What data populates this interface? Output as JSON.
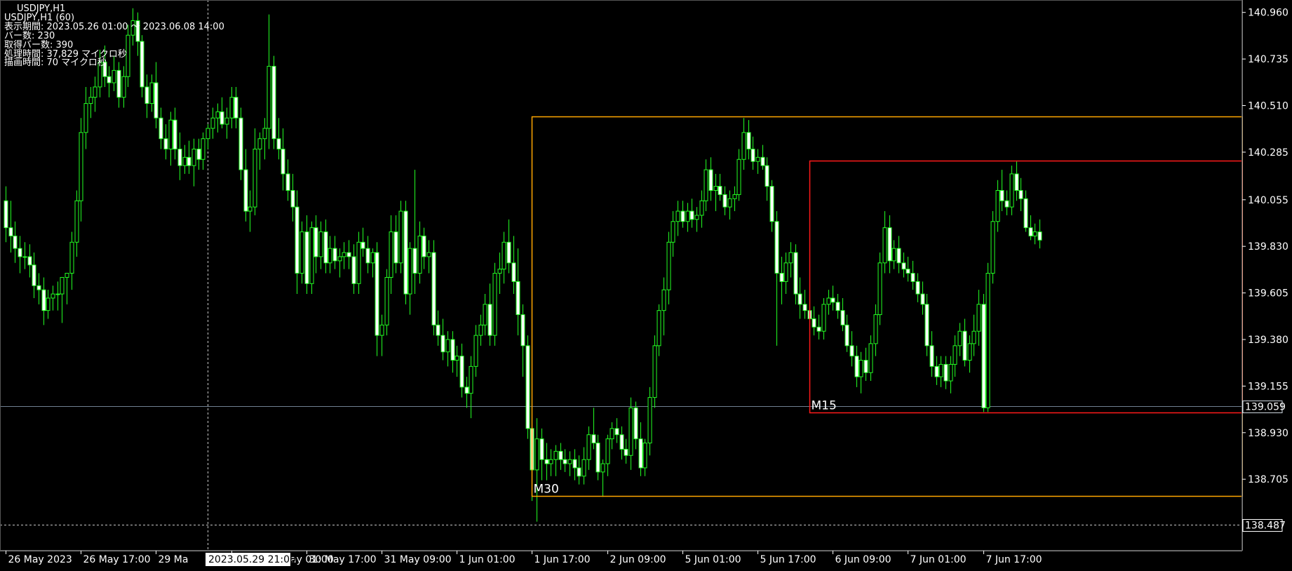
{
  "window": {
    "symbol_title": "USDJPY,H1"
  },
  "info_panel": {
    "lines": [
      "USDJPY,H1 (60)",
      "表示期間: 2023.05.26 01:00 ～ 2023.06.08 14:00",
      "バー数: 230",
      "取得バー数: 390",
      "処理時間: 37,829 マイクロ秒",
      "描画時間: 70 マイクロ秒"
    ]
  },
  "colors": {
    "background": "#000000",
    "candle": "#22ff22",
    "candle_body_up": "#000000",
    "candle_body_down": "#ffffff",
    "axis": "#ffffff",
    "box_m30": "#ffa500",
    "box_m15": "#ff1a1a",
    "bid_line": "#708090",
    "crosshair": "#c8c8c8"
  },
  "chart_data": {
    "type": "candlestick",
    "symbol": "USDJPY",
    "timeframe": "H1",
    "ylim": [
      138.36,
      141.02
    ],
    "grid": false,
    "price_ticks": [
      "140.960",
      "140.735",
      "140.510",
      "140.285",
      "140.055",
      "139.830",
      "139.605",
      "139.380",
      "139.155",
      "138.930",
      "138.705"
    ],
    "time_ticks": [
      "26 May 2023",
      "26 May 17:00",
      "29 May 09:00",
      "30 May 01:00",
      "30 May 17:00",
      "31 May 09:00",
      "1 Jun 01:00",
      "1 Jun 17:00",
      "2 Jun 09:00",
      "5 Jun 01:00",
      "5 Jun 17:00",
      "6 Jun 09:00",
      "7 Jun 01:00",
      "7 Jun 17:00"
    ],
    "time_tick_visible_text": [
      "26 May 2023",
      "26 May 17:00",
      "29 Ma",
      "ay 01:00",
      "30 May 17:00",
      "31 May 09:00",
      "1 Jun 01:00",
      "1 Jun 17:00",
      "2 Jun 09:00",
      "5 Jun 01:00",
      "5 Jun 17:00",
      "6 Jun 09:00",
      "7 Jun 01:00",
      "7 Jun 17:00"
    ],
    "time_tick_bar_index": [
      0,
      16,
      32,
      48,
      64,
      80,
      96,
      112,
      128,
      144,
      160,
      176,
      192,
      208
    ],
    "bid_price": 139.059,
    "bid_label": "139.059",
    "crosshair": {
      "bar_index": 43,
      "price": 138.487,
      "price_label": "138.487",
      "time_label": "2023.05.29 21:00"
    },
    "boxes": [
      {
        "label": "M30",
        "start_bar": 112,
        "end_bar": 221,
        "high": 140.457,
        "low": 138.625
      },
      {
        "label": "M15",
        "start_bar": 171,
        "end_bar": 221,
        "high": 140.245,
        "low": 139.028
      }
    ],
    "ohlc": [
      [
        140.05,
        140.12,
        139.85,
        139.92
      ],
      [
        139.92,
        140.05,
        139.8,
        139.88
      ],
      [
        139.88,
        139.95,
        139.75,
        139.82
      ],
      [
        139.82,
        139.88,
        139.7,
        139.78
      ],
      [
        139.78,
        139.85,
        139.72,
        139.78
      ],
      [
        139.78,
        139.84,
        139.68,
        139.74
      ],
      [
        139.74,
        139.8,
        139.58,
        139.64
      ],
      [
        139.64,
        139.7,
        139.55,
        139.62
      ],
      [
        139.62,
        139.68,
        139.45,
        139.52
      ],
      [
        139.52,
        139.62,
        139.48,
        139.58
      ],
      [
        139.58,
        139.64,
        139.52,
        139.6
      ],
      [
        139.6,
        139.66,
        139.52,
        139.6
      ],
      [
        139.6,
        139.66,
        139.46,
        139.68
      ],
      [
        139.68,
        139.7,
        139.55,
        139.7
      ],
      [
        139.7,
        139.9,
        139.62,
        139.85
      ],
      [
        139.85,
        140.1,
        139.78,
        140.05
      ],
      [
        140.05,
        140.45,
        139.95,
        140.38
      ],
      [
        140.38,
        140.6,
        140.3,
        140.52
      ],
      [
        140.52,
        140.6,
        140.45,
        140.55
      ],
      [
        140.55,
        140.65,
        140.48,
        140.6
      ],
      [
        140.6,
        140.78,
        140.55,
        140.72
      ],
      [
        140.72,
        140.8,
        140.6,
        140.65
      ],
      [
        140.65,
        140.7,
        140.55,
        140.62
      ],
      [
        140.62,
        140.75,
        140.58,
        140.68
      ],
      [
        140.68,
        140.72,
        140.5,
        140.55
      ],
      [
        140.55,
        140.7,
        140.5,
        140.65
      ],
      [
        140.65,
        140.9,
        140.6,
        140.85
      ],
      [
        140.85,
        140.98,
        140.8,
        140.92
      ],
      [
        140.92,
        140.96,
        140.75,
        140.82
      ],
      [
        140.82,
        140.85,
        140.55,
        140.6
      ],
      [
        140.6,
        140.66,
        140.45,
        140.52
      ],
      [
        140.52,
        140.66,
        140.48,
        140.62
      ],
      [
        140.62,
        140.72,
        140.4,
        140.45
      ],
      [
        140.45,
        140.5,
        140.3,
        140.35
      ],
      [
        140.35,
        140.42,
        140.25,
        140.3
      ],
      [
        140.3,
        140.48,
        140.22,
        140.44
      ],
      [
        140.44,
        140.5,
        140.25,
        140.3
      ],
      [
        140.3,
        140.38,
        140.15,
        140.22
      ],
      [
        140.22,
        140.32,
        140.18,
        140.26
      ],
      [
        140.26,
        140.34,
        140.18,
        140.22
      ],
      [
        140.22,
        140.35,
        140.12,
        140.3
      ],
      [
        140.3,
        140.35,
        140.2,
        140.25
      ],
      [
        140.25,
        140.38,
        140.2,
        140.35
      ],
      [
        140.35,
        140.42,
        140.3,
        140.4
      ],
      [
        140.4,
        140.5,
        140.35,
        140.45
      ],
      [
        140.45,
        140.52,
        140.38,
        140.48
      ],
      [
        140.48,
        140.55,
        140.4,
        140.42
      ],
      [
        140.42,
        140.5,
        140.35,
        140.45
      ],
      [
        140.45,
        140.6,
        140.4,
        140.55
      ],
      [
        140.55,
        140.6,
        140.4,
        140.45
      ],
      [
        140.45,
        140.5,
        140.15,
        140.2
      ],
      [
        140.2,
        140.3,
        139.95,
        140.0
      ],
      [
        140.0,
        140.1,
        139.9,
        140.02
      ],
      [
        140.02,
        140.4,
        139.98,
        140.3
      ],
      [
        140.3,
        140.38,
        140.2,
        140.35
      ],
      [
        140.35,
        140.45,
        140.25,
        140.4
      ],
      [
        140.4,
        140.95,
        140.3,
        140.7
      ],
      [
        140.7,
        140.75,
        140.3,
        140.35
      ],
      [
        140.35,
        140.45,
        140.25,
        140.3
      ],
      [
        140.3,
        140.4,
        140.1,
        140.18
      ],
      [
        140.18,
        140.25,
        140.05,
        140.1
      ],
      [
        140.1,
        140.18,
        139.95,
        140.02
      ],
      [
        140.02,
        140.1,
        139.6,
        139.7
      ],
      [
        139.7,
        139.95,
        139.65,
        139.9
      ],
      [
        139.9,
        139.98,
        139.6,
        139.65
      ],
      [
        139.65,
        139.95,
        139.6,
        139.92
      ],
      [
        139.92,
        139.98,
        139.7,
        139.78
      ],
      [
        139.78,
        139.95,
        139.72,
        139.9
      ],
      [
        139.9,
        139.96,
        139.7,
        139.75
      ],
      [
        139.75,
        139.88,
        139.7,
        139.82
      ],
      [
        139.82,
        139.88,
        139.72,
        139.76
      ],
      [
        139.76,
        139.82,
        139.68,
        139.78
      ],
      [
        139.78,
        139.85,
        139.72,
        139.8
      ],
      [
        139.8,
        139.86,
        139.72,
        139.78
      ],
      [
        139.78,
        139.84,
        139.6,
        139.65
      ],
      [
        139.65,
        139.9,
        139.6,
        139.85
      ],
      [
        139.85,
        139.92,
        139.78,
        139.82
      ],
      [
        139.82,
        139.88,
        139.7,
        139.75
      ],
      [
        139.75,
        139.82,
        139.68,
        139.8
      ],
      [
        139.8,
        139.85,
        139.3,
        139.4
      ],
      [
        139.4,
        139.5,
        139.3,
        139.45
      ],
      [
        139.45,
        139.72,
        139.4,
        139.68
      ],
      [
        139.68,
        139.98,
        139.6,
        139.9
      ],
      [
        139.9,
        139.98,
        139.7,
        139.75
      ],
      [
        139.75,
        140.05,
        139.7,
        140.0
      ],
      [
        140.0,
        140.05,
        139.55,
        139.6
      ],
      [
        139.6,
        139.85,
        139.5,
        139.82
      ],
      [
        139.82,
        140.2,
        139.6,
        139.7
      ],
      [
        139.7,
        139.95,
        139.65,
        139.88
      ],
      [
        139.88,
        139.92,
        139.72,
        139.78
      ],
      [
        139.78,
        139.86,
        139.7,
        139.8
      ],
      [
        139.8,
        139.86,
        139.4,
        139.45
      ],
      [
        139.45,
        139.52,
        139.35,
        139.4
      ],
      [
        139.4,
        139.48,
        139.28,
        139.32
      ],
      [
        139.32,
        139.42,
        139.25,
        139.38
      ],
      [
        139.38,
        139.42,
        139.22,
        139.28
      ],
      [
        139.28,
        139.35,
        139.2,
        139.3
      ],
      [
        139.3,
        139.36,
        139.1,
        139.15
      ],
      [
        139.15,
        139.2,
        139.05,
        139.12
      ],
      [
        139.12,
        139.3,
        139.0,
        139.25
      ],
      [
        139.25,
        139.45,
        139.2,
        139.4
      ],
      [
        139.4,
        139.5,
        139.35,
        139.45
      ],
      [
        139.45,
        139.6,
        139.4,
        139.55
      ],
      [
        139.55,
        139.65,
        139.35,
        139.4
      ],
      [
        139.4,
        139.75,
        139.35,
        139.7
      ],
      [
        139.7,
        139.8,
        139.6,
        139.72
      ],
      [
        139.72,
        139.9,
        139.65,
        139.85
      ],
      [
        139.85,
        139.96,
        139.7,
        139.75
      ],
      [
        139.75,
        139.88,
        139.6,
        139.66
      ],
      [
        139.66,
        139.82,
        139.4,
        139.5
      ],
      [
        139.5,
        139.55,
        139.2,
        139.35
      ],
      [
        139.35,
        139.4,
        138.9,
        138.95
      ],
      [
        138.95,
        139.05,
        138.6,
        138.75
      ],
      [
        138.75,
        139.0,
        138.5,
        138.9
      ],
      [
        138.9,
        138.95,
        138.7,
        138.8
      ],
      [
        138.8,
        138.88,
        138.7,
        138.78
      ],
      [
        138.78,
        138.85,
        138.72,
        138.8
      ],
      [
        138.8,
        138.87,
        138.72,
        138.84
      ],
      [
        138.84,
        138.88,
        138.75,
        138.8
      ],
      [
        138.8,
        138.85,
        138.74,
        138.78
      ],
      [
        138.78,
        138.84,
        138.72,
        138.8
      ],
      [
        138.8,
        138.85,
        138.7,
        138.76
      ],
      [
        138.76,
        138.82,
        138.68,
        138.72
      ],
      [
        138.72,
        138.86,
        138.68,
        138.8
      ],
      [
        138.8,
        138.96,
        138.75,
        138.92
      ],
      [
        138.92,
        139.05,
        138.85,
        138.88
      ],
      [
        138.88,
        138.92,
        138.7,
        138.74
      ],
      [
        138.74,
        138.8,
        138.62,
        138.78
      ],
      [
        138.78,
        138.92,
        138.72,
        138.9
      ],
      [
        138.9,
        138.98,
        138.85,
        138.95
      ],
      [
        138.95,
        139.0,
        138.88,
        138.92
      ],
      [
        138.92,
        138.96,
        138.8,
        138.85
      ],
      [
        138.85,
        138.9,
        138.78,
        138.82
      ],
      [
        138.82,
        139.1,
        138.75,
        139.05
      ],
      [
        139.05,
        139.08,
        138.85,
        138.9
      ],
      [
        138.9,
        138.98,
        138.72,
        138.76
      ],
      [
        138.76,
        138.9,
        138.72,
        138.88
      ],
      [
        138.88,
        139.15,
        138.82,
        139.1
      ],
      [
        139.1,
        139.4,
        139.05,
        139.35
      ],
      [
        139.35,
        139.55,
        139.3,
        139.52
      ],
      [
        139.52,
        139.68,
        139.4,
        139.62
      ],
      [
        139.62,
        139.9,
        139.55,
        139.85
      ],
      [
        139.85,
        140.0,
        139.78,
        139.95
      ],
      [
        139.95,
        140.05,
        139.88,
        140.0
      ],
      [
        140.0,
        140.05,
        139.92,
        139.95
      ],
      [
        139.95,
        140.04,
        139.9,
        140.0
      ],
      [
        140.0,
        140.06,
        139.92,
        139.96
      ],
      [
        139.96,
        140.02,
        139.9,
        139.98
      ],
      [
        139.98,
        140.1,
        139.92,
        140.05
      ],
      [
        140.05,
        140.25,
        140.0,
        140.2
      ],
      [
        140.2,
        140.26,
        140.05,
        140.1
      ],
      [
        140.1,
        140.18,
        140.0,
        140.12
      ],
      [
        140.12,
        140.18,
        140.05,
        140.08
      ],
      [
        140.08,
        140.12,
        139.98,
        140.02
      ],
      [
        140.02,
        140.1,
        139.96,
        140.06
      ],
      [
        140.06,
        140.12,
        140.0,
        140.08
      ],
      [
        140.08,
        140.3,
        140.05,
        140.25
      ],
      [
        140.25,
        140.45,
        140.2,
        140.38
      ],
      [
        140.38,
        140.44,
        140.25,
        140.3
      ],
      [
        140.3,
        140.36,
        140.2,
        140.24
      ],
      [
        140.24,
        140.3,
        140.18,
        140.26
      ],
      [
        140.26,
        140.32,
        140.2,
        140.22
      ],
      [
        140.22,
        140.26,
        140.05,
        140.12
      ],
      [
        140.12,
        140.15,
        139.9,
        139.95
      ],
      [
        139.95,
        140.0,
        139.35,
        139.7
      ],
      [
        139.7,
        139.78,
        139.55,
        139.66
      ],
      [
        139.66,
        139.8,
        139.6,
        139.75
      ],
      [
        139.75,
        139.85,
        139.68,
        139.8
      ],
      [
        139.8,
        139.84,
        139.55,
        139.6
      ],
      [
        139.6,
        139.68,
        139.48,
        139.55
      ],
      [
        139.55,
        139.62,
        139.48,
        139.52
      ],
      [
        139.52,
        139.56,
        139.45,
        139.48
      ],
      [
        139.48,
        139.54,
        139.4,
        139.44
      ],
      [
        139.44,
        139.5,
        139.38,
        139.42
      ],
      [
        139.42,
        139.58,
        139.38,
        139.55
      ],
      [
        139.55,
        139.62,
        139.5,
        139.58
      ],
      [
        139.58,
        139.64,
        139.52,
        139.56
      ],
      [
        139.56,
        139.6,
        139.48,
        139.52
      ],
      [
        139.52,
        139.58,
        139.42,
        139.45
      ],
      [
        139.45,
        139.5,
        139.32,
        139.35
      ],
      [
        139.35,
        139.42,
        139.25,
        139.3
      ],
      [
        139.3,
        139.35,
        139.15,
        139.2
      ],
      [
        139.2,
        139.32,
        139.12,
        139.28
      ],
      [
        139.28,
        139.34,
        139.18,
        139.22
      ],
      [
        139.22,
        139.4,
        139.18,
        139.36
      ],
      [
        139.36,
        139.55,
        139.3,
        139.5
      ],
      [
        139.5,
        139.8,
        139.45,
        139.75
      ],
      [
        139.75,
        140.0,
        139.7,
        139.92
      ],
      [
        139.92,
        139.98,
        139.7,
        139.76
      ],
      [
        139.76,
        139.86,
        139.72,
        139.82
      ],
      [
        139.82,
        139.88,
        139.7,
        139.75
      ],
      [
        139.75,
        139.8,
        139.68,
        139.72
      ],
      [
        139.72,
        139.78,
        139.66,
        139.7
      ],
      [
        139.7,
        139.76,
        139.62,
        139.66
      ],
      [
        139.66,
        139.7,
        139.56,
        139.6
      ],
      [
        139.6,
        139.66,
        139.5,
        139.55
      ],
      [
        139.55,
        139.6,
        139.3,
        139.35
      ],
      [
        139.35,
        139.42,
        139.2,
        139.25
      ],
      [
        139.25,
        139.3,
        139.16,
        139.2
      ],
      [
        139.2,
        139.3,
        139.15,
        139.26
      ],
      [
        139.26,
        139.3,
        139.14,
        139.18
      ],
      [
        139.18,
        139.3,
        139.12,
        139.26
      ],
      [
        139.26,
        139.4,
        139.2,
        139.35
      ],
      [
        139.35,
        139.46,
        139.3,
        139.42
      ],
      [
        139.42,
        139.48,
        139.25,
        139.28
      ],
      [
        139.28,
        139.4,
        139.22,
        139.36
      ],
      [
        139.36,
        139.5,
        139.3,
        139.42
      ],
      [
        139.42,
        139.62,
        139.35,
        139.55
      ],
      [
        139.55,
        139.6,
        139.03,
        139.05
      ],
      [
        139.05,
        139.75,
        139.03,
        139.7
      ],
      [
        139.7,
        140.0,
        139.65,
        139.95
      ],
      [
        139.95,
        140.15,
        139.9,
        140.1
      ],
      [
        140.1,
        140.2,
        140.0,
        140.05
      ],
      [
        140.05,
        140.1,
        139.98,
        140.02
      ],
      [
        140.02,
        140.22,
        139.98,
        140.18
      ],
      [
        140.18,
        140.24,
        140.05,
        140.1
      ],
      [
        140.1,
        140.16,
        140.0,
        140.06
      ],
      [
        140.06,
        140.1,
        139.9,
        139.92
      ],
      [
        139.92,
        139.98,
        139.86,
        139.88
      ],
      [
        139.88,
        139.94,
        139.84,
        139.9
      ],
      [
        139.9,
        139.96,
        139.82,
        139.86
      ]
    ]
  }
}
